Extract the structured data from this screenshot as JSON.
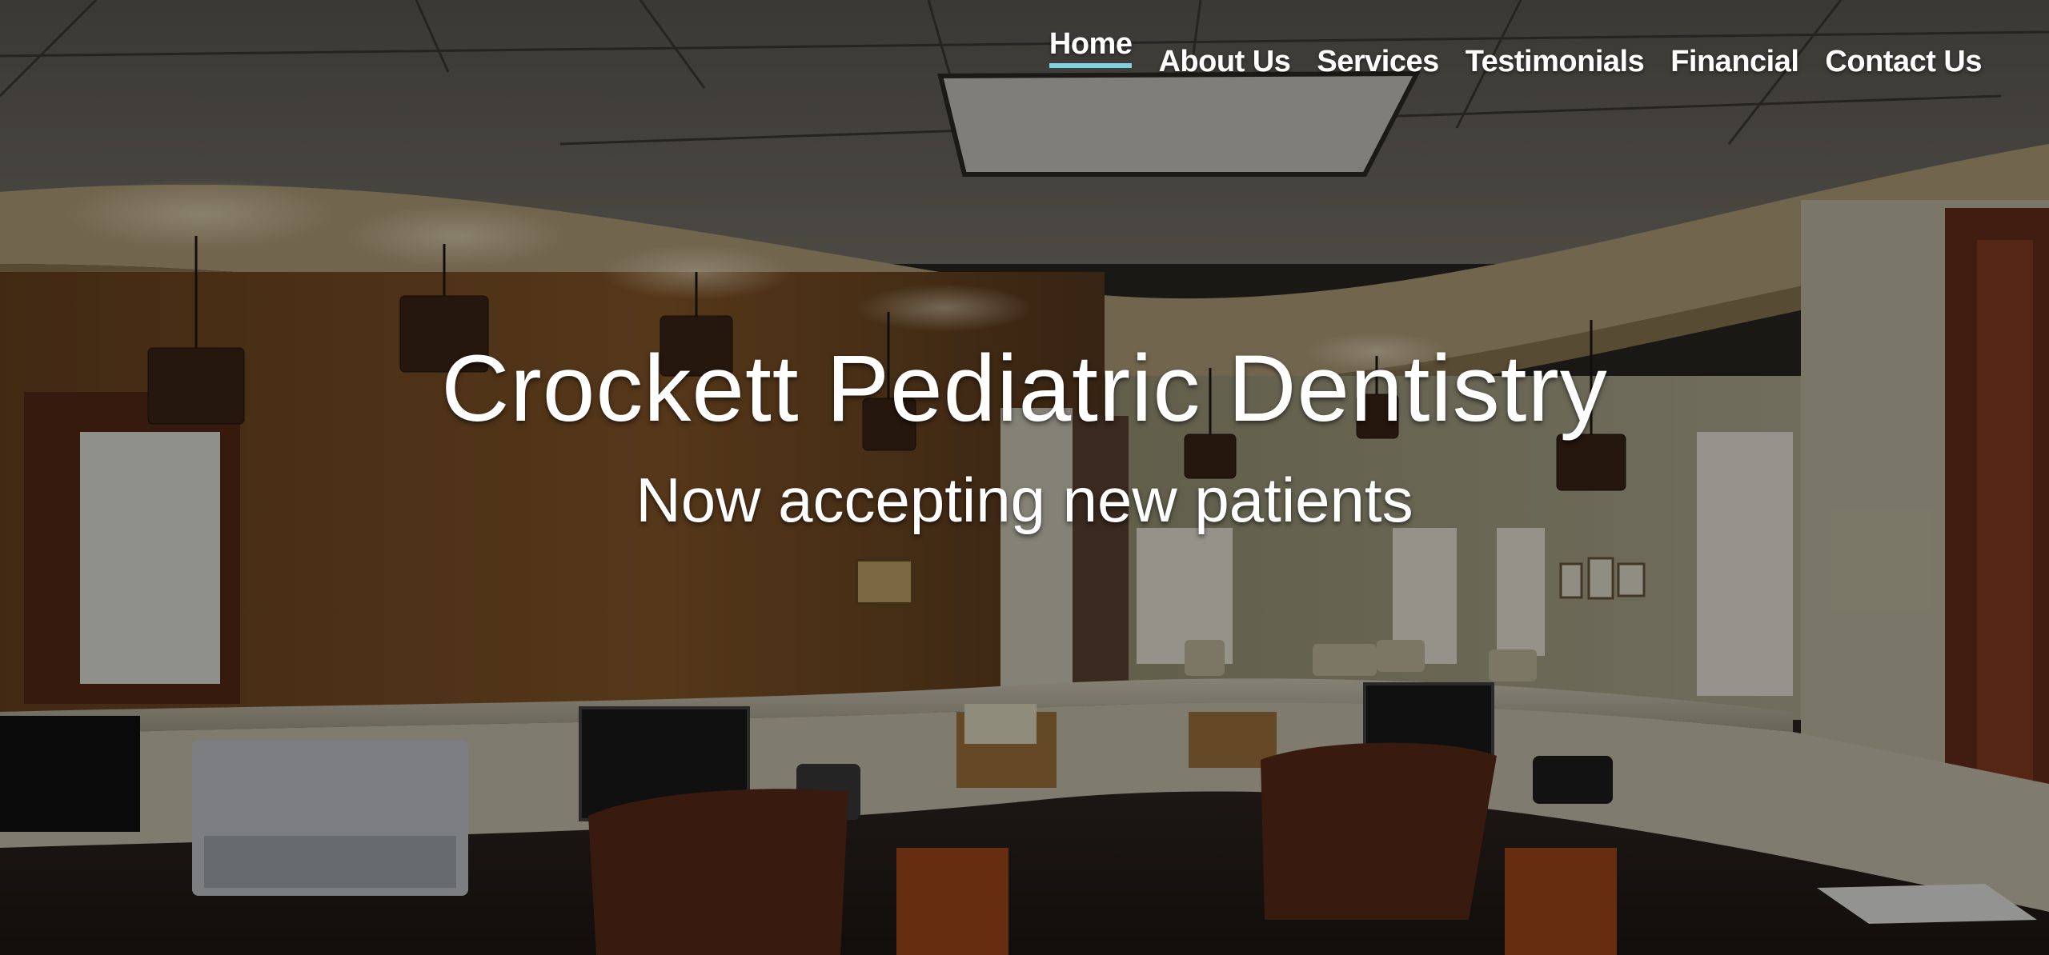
{
  "nav": {
    "items": [
      {
        "label": "Home",
        "active": true
      },
      {
        "label": "About Us",
        "active": false
      },
      {
        "label": "Services",
        "active": false
      },
      {
        "label": "Testimonials",
        "active": false
      },
      {
        "label": "Financial",
        "active": false
      },
      {
        "label": "Contact Us",
        "active": false
      }
    ],
    "accent_color": "#7fd3de"
  },
  "hero": {
    "title": "Crockett Pediatric Dentistry",
    "subtitle": "Now accepting new patients",
    "background_image": "dental office reception area photo"
  }
}
